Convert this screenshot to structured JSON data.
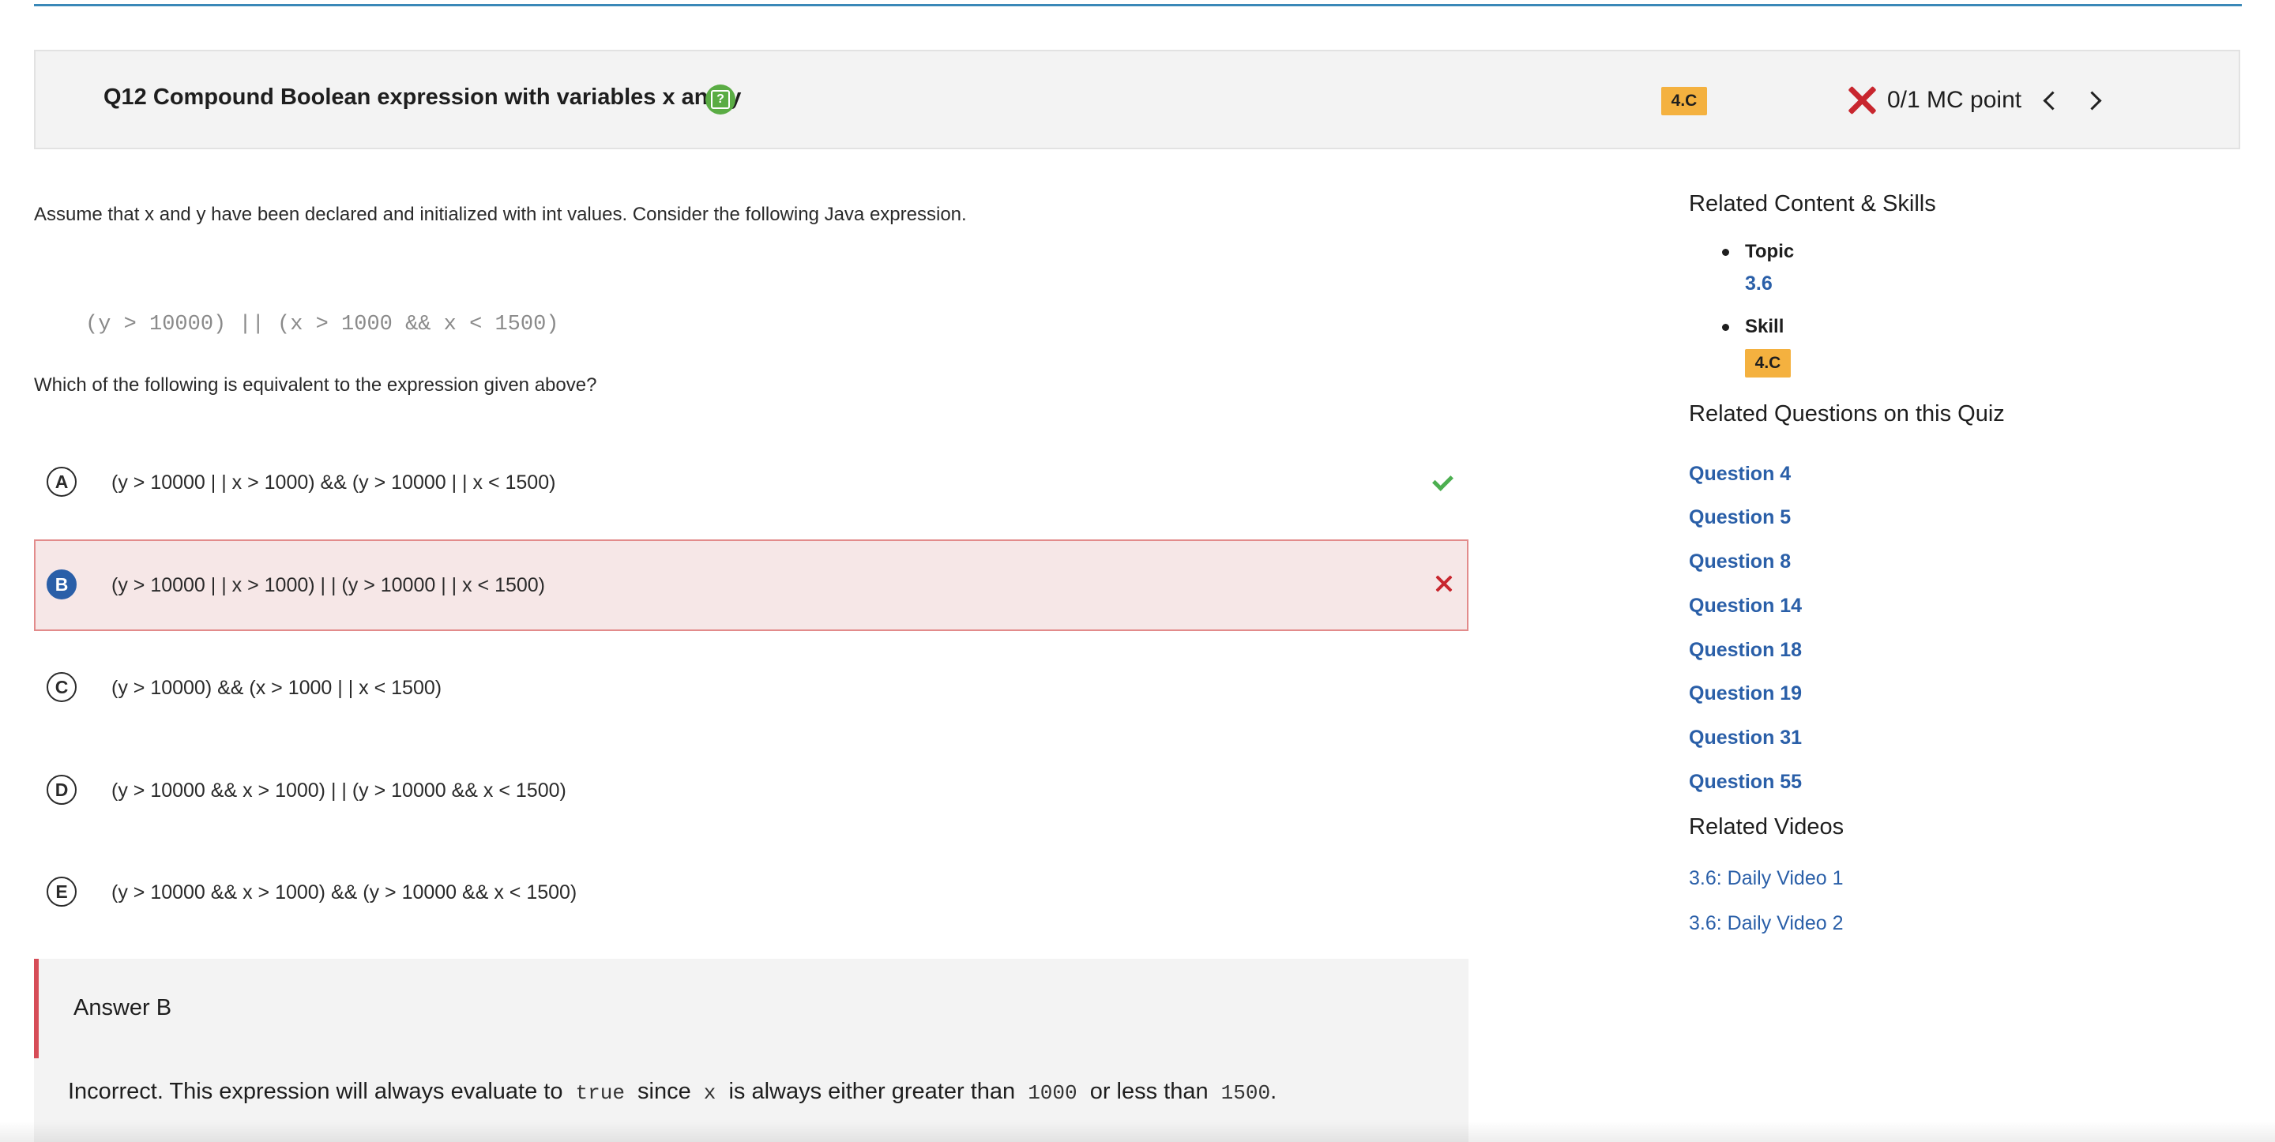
{
  "header": {
    "title": "Q12 Compound Boolean expression with variables x and y",
    "skill_badge": "4.C",
    "score": "0/1 MC point"
  },
  "question": {
    "stem": "Assume that x and y have been declared and initialized with int values. Consider the following Java expression.",
    "code": "(y > 10000) || (x > 1000 && x < 1500)",
    "prompt": "Which of the following is equivalent to the expression given above?"
  },
  "choices": [
    {
      "letter": "A",
      "text": "(y > 10000 | | x > 1000) && (y > 10000 | | x < 1500)",
      "status": "correct"
    },
    {
      "letter": "B",
      "text": "(y > 10000 | | x > 1000) | | (y > 10000 | | x < 1500)",
      "status": "selected-incorrect"
    },
    {
      "letter": "C",
      "text": "(y > 10000) && (x > 1000 | | x < 1500)",
      "status": "none"
    },
    {
      "letter": "D",
      "text": "(y > 10000 && x > 1000) | | (y > 10000 && x < 1500)",
      "status": "none"
    },
    {
      "letter": "E",
      "text": "(y > 10000 && x > 1000) && (y > 10000 && x < 1500)",
      "status": "none"
    }
  ],
  "answer": {
    "title": "Answer B",
    "expl_1": "Incorrect. This expression will always evaluate to",
    "code_true": "true",
    "expl_2": "since",
    "code_x": "x",
    "expl_3": "is always either greater than",
    "code_1000": "1000",
    "expl_4": "or less than",
    "code_1500": "1500",
    "expl_5": "."
  },
  "sidebar": {
    "related_heading": "Related Content & Skills",
    "topic_label": "Topic",
    "topic_value": "3.6",
    "skill_label": "Skill",
    "skill_value": "4.C",
    "questions_heading": "Related Questions on this Quiz",
    "questions": [
      "Question 4",
      "Question 5",
      "Question 8",
      "Question 14",
      "Question 18",
      "Question 19",
      "Question 31",
      "Question 55"
    ],
    "videos_heading": "Related Videos",
    "videos": [
      "3.6: Daily Video 1",
      "3.6: Daily Video 2"
    ]
  },
  "colors": {
    "accent_blue": "#2a5fa8",
    "skill_badge": "#f4b13f",
    "incorrect_red": "#c8262e",
    "correct_green": "#4caf50",
    "selected_bg": "#f6e7e7"
  }
}
